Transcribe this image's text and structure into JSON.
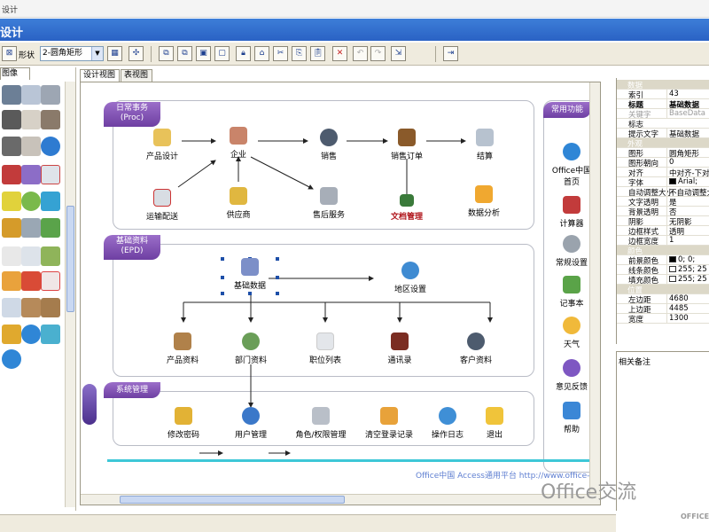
{
  "window": {
    "title": "设计"
  },
  "header": {
    "title": "设计"
  },
  "toolbar": {
    "shape_label": "形状",
    "shape_value": "2-圆角矩形"
  },
  "left_panel": {
    "tab": "图像"
  },
  "tabs": [
    {
      "label": "设计视图"
    },
    {
      "label": "表视图"
    }
  ],
  "groups": {
    "daily": {
      "title": "日常事务",
      "subtitle": "(Proc)"
    },
    "basic": {
      "title": "基础资料",
      "subtitle": "(EPD)"
    },
    "system": {
      "title": "系统管理"
    },
    "common": {
      "title": "常用功能"
    }
  },
  "nodes": {
    "product_design": "产品设计",
    "enterprise": "企业",
    "sales": "销售",
    "sales_order": "销售订单",
    "settlement": "结算",
    "transport": "运输配送",
    "supplier": "供应商",
    "after_sales": "售后服务",
    "doc_mgmt": "文档管理",
    "data_analysis": "数据分析",
    "basic_data": "基础数据",
    "region_setting": "地区设置",
    "product_info": "产品资料",
    "dept_info": "部门资料",
    "position_list": "职位列表",
    "address_book": "通讯录",
    "customer_info": "客户资料",
    "change_pwd": "修改密码",
    "user_mgmt": "用户管理",
    "role_perm": "角色/权限管理",
    "clear_login": "清空登录记录",
    "op_log": "操作日志",
    "logout": "退出",
    "office_home": "Office中国",
    "office_home2": "首页",
    "calculator": "计算器",
    "common_settings": "常规设置",
    "notepad": "记事本",
    "weather": "天气",
    "feedback": "意见反馈",
    "help": "帮助"
  },
  "footer": {
    "text": "Office中国 Access通用平台 http://www.office-"
  },
  "properties": {
    "rows": [
      {
        "k": "数据",
        "v": "",
        "type": "sec"
      },
      {
        "k": "索引",
        "v": "43"
      },
      {
        "k": "标题",
        "v": "基础数据",
        "type": "bold"
      },
      {
        "k": "关键字",
        "v": "BaseData",
        "type": "grey"
      },
      {
        "k": "标志",
        "v": ""
      },
      {
        "k": "提示文字",
        "v": "基础数据"
      },
      {
        "k": "外观",
        "v": "",
        "type": "sec"
      },
      {
        "k": "图形",
        "v": "圆角矩形"
      },
      {
        "k": "图形朝向",
        "v": "0"
      },
      {
        "k": "对齐",
        "v": "中对齐-下对齐"
      },
      {
        "k": "字体",
        "v": "Arial;",
        "swatch": "#000000"
      },
      {
        "k": "自动调整大小",
        "v": "不自动调整大小"
      },
      {
        "k": "文字透明",
        "v": "是"
      },
      {
        "k": "背景透明",
        "v": "否"
      },
      {
        "k": "阴影",
        "v": "无阴影"
      },
      {
        "k": "边框样式",
        "v": "透明"
      },
      {
        "k": "边框宽度",
        "v": "1"
      },
      {
        "k": "颜色",
        "v": "",
        "type": "sec"
      },
      {
        "k": "前景颜色",
        "v": "0; 0;",
        "swatch": "#000000"
      },
      {
        "k": "线条颜色",
        "v": "255; 25",
        "swatch": "#ffffff"
      },
      {
        "k": "填充颜色",
        "v": "255; 25",
        "swatch": "#ffffff"
      },
      {
        "k": "位置",
        "v": "",
        "type": "sec"
      },
      {
        "k": "左边距",
        "v": "4680"
      },
      {
        "k": "上边距",
        "v": "4485"
      },
      {
        "k": "宽度",
        "v": "1300"
      }
    ]
  },
  "remark": {
    "label": "相关备注"
  },
  "watermark": {
    "text": "Office交流",
    "small": "OFFICE"
  },
  "colors": {
    "group_tag": "#7a4bb0",
    "accent_line": "#3ec7d7",
    "header": "#2f6dd0",
    "doc_red": "#b0151b"
  }
}
